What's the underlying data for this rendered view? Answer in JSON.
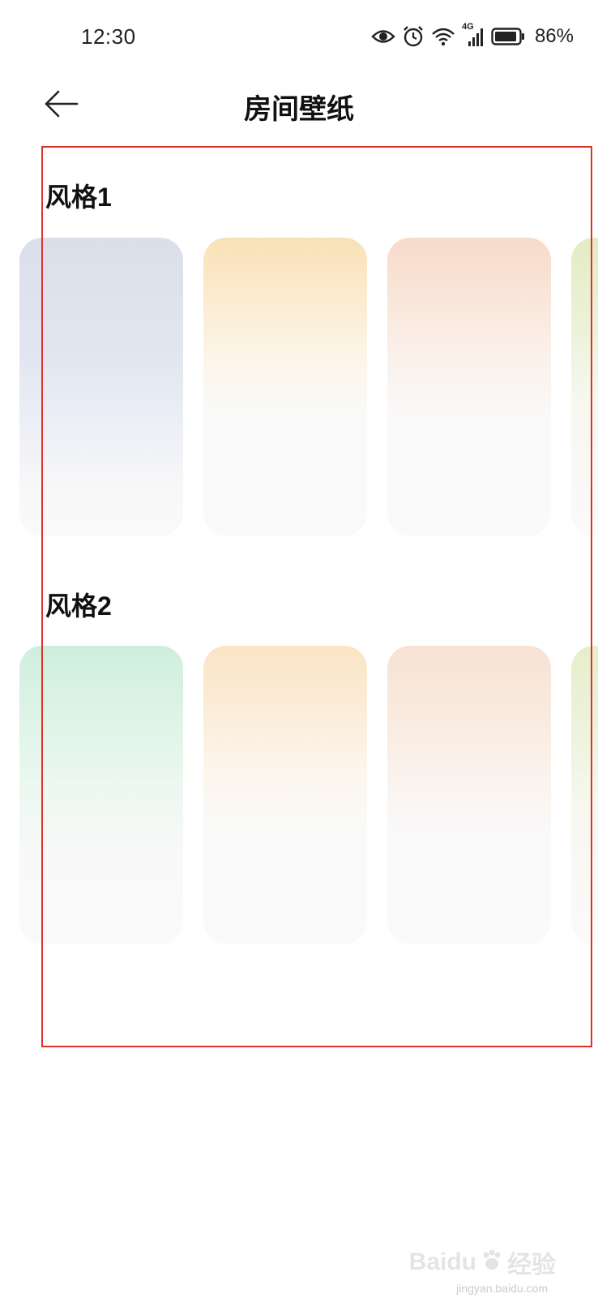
{
  "status_bar": {
    "time": "12:30",
    "network_label": "4G",
    "battery_percent": "86%",
    "icons": [
      "eye-icon",
      "alarm-icon",
      "wifi-icon",
      "cellular-signal-icon",
      "battery-icon"
    ]
  },
  "header": {
    "title": "房间壁纸",
    "back_icon": "back-arrow-icon"
  },
  "sections": [
    {
      "title": "风格1",
      "cards": [
        {
          "top_color": "#dadfea"
        },
        {
          "top_color": "#f9e1b6"
        },
        {
          "top_color": "#f7dbc9"
        },
        {
          "top_color": "#e3ecc3"
        }
      ]
    },
    {
      "title": "风格2",
      "cards": [
        {
          "top_color": "#cfeedd"
        },
        {
          "top_color": "#fae5c4"
        },
        {
          "top_color": "#f8e2d4"
        },
        {
          "top_color": "#e6eecb"
        }
      ]
    }
  ],
  "annotation": {
    "frame_color": "#e0322b"
  },
  "watermark": {
    "brand": "Baidu",
    "brand_cn": "经验",
    "domain": "jingyan.baidu.com"
  }
}
